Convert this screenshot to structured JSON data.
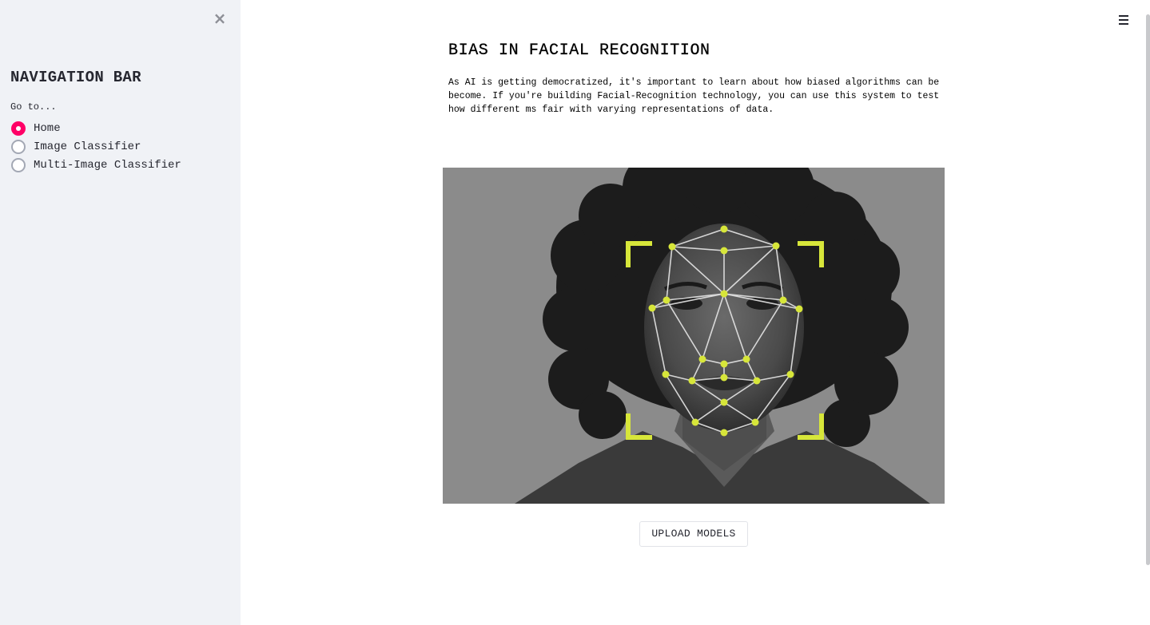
{
  "sidebar": {
    "close_icon": "×",
    "title": "NAVIGATION BAR",
    "goto_label": "Go to...",
    "options": [
      {
        "label": "Home",
        "selected": true
      },
      {
        "label": "Image Classifier",
        "selected": false
      },
      {
        "label": "Multi-Image Classifier",
        "selected": false
      }
    ]
  },
  "header": {
    "menu_icon": "hamburger-icon"
  },
  "main": {
    "title": "BIAS IN FACIAL RECOGNITION",
    "intro": "As AI is getting democratized, it's important to learn about how biased algorithms can be become. If you're building Facial-Recognition technology, you can use this system to test how different ms fair with varying representations of data.",
    "upload_label": "UPLOAD MODELS"
  },
  "colors": {
    "accent": "#ff0066",
    "sidebar_bg": "#f0f2f6",
    "landmark": "#d7e63a"
  }
}
